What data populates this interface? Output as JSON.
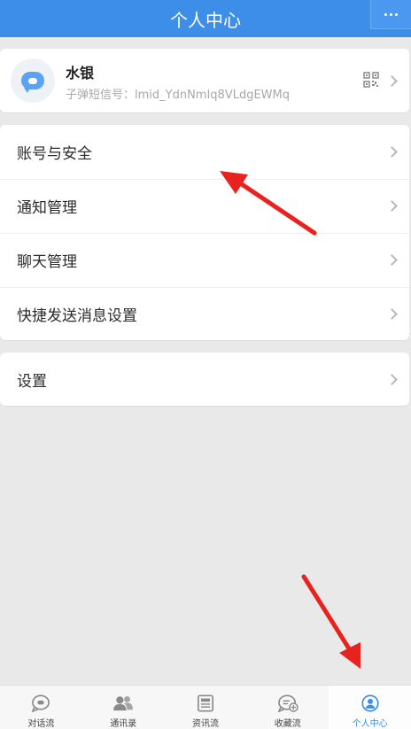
{
  "header": {
    "title": "个人中心",
    "more_icon": "more-dots-icon"
  },
  "profile": {
    "name": "水银",
    "sub": "子弹短信号：lmid_YdnNmIq8VLdgEWMq",
    "avatar_icon": "chat-bubble-icon",
    "qr_icon": "qr-code-icon"
  },
  "menu": {
    "items": [
      {
        "label": "账号与安全"
      },
      {
        "label": "通知管理"
      },
      {
        "label": "聊天管理"
      },
      {
        "label": "快捷发送消息设置"
      }
    ],
    "settings": {
      "label": "设置"
    }
  },
  "tabs": [
    {
      "label": "对话流",
      "icon": "chat-icon",
      "active": false
    },
    {
      "label": "通讯录",
      "icon": "contacts-icon",
      "active": false
    },
    {
      "label": "资讯流",
      "icon": "news-icon",
      "active": false
    },
    {
      "label": "收藏流",
      "icon": "favorites-icon",
      "active": false
    },
    {
      "label": "个人中心",
      "icon": "profile-icon",
      "active": true
    }
  ],
  "colors": {
    "accent": "#3d8ee8",
    "annotation": "#e8231f"
  }
}
